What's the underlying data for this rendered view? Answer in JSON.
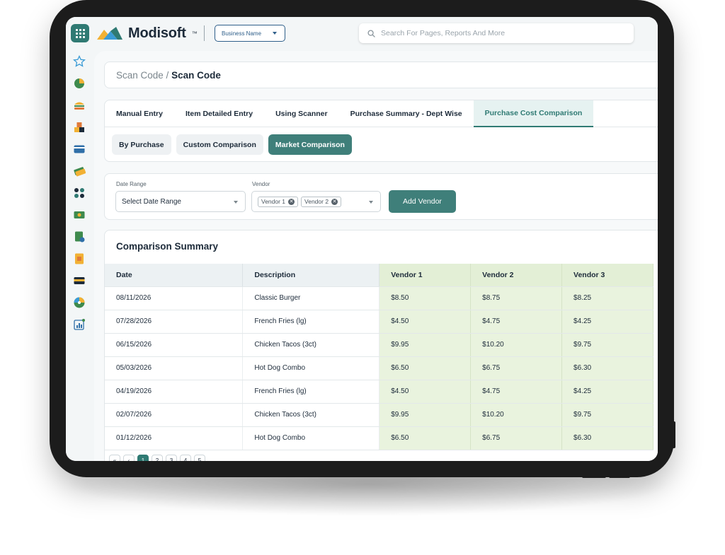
{
  "header": {
    "brand": "Modisoft",
    "business_select": "Business Name",
    "search_placeholder": "Search For Pages, Reports And More"
  },
  "breadcrumb": {
    "parent": "Scan Code /",
    "current": "Scan Code"
  },
  "tabs": [
    {
      "label": "Manual Entry",
      "active": false
    },
    {
      "label": "Item Detailed Entry",
      "active": false
    },
    {
      "label": "Using Scanner",
      "active": false
    },
    {
      "label": "Purchase Summary - Dept Wise",
      "active": false
    },
    {
      "label": "Purchase Cost Comparison",
      "active": true
    }
  ],
  "subtabs": [
    {
      "label": "By Purchase",
      "active": false
    },
    {
      "label": "Custom Comparison",
      "active": false
    },
    {
      "label": "Market Comparison",
      "active": true
    }
  ],
  "filters": {
    "date_range_label": "Date Range",
    "date_range_value": "Select Date Range",
    "vendor_label": "Vendor",
    "vendor_chips": [
      "Vendor 1",
      "Vendor 2"
    ],
    "add_vendor": "Add Vendor"
  },
  "summary": {
    "title": "Comparison Summary",
    "columns": [
      "Date",
      "Description",
      "Vendor 1",
      "Vendor 2",
      "Vendor 3"
    ],
    "rows": [
      [
        "08/11/2026",
        "Classic Burger",
        "$8.50",
        "$8.75",
        "$8.25"
      ],
      [
        "07/28/2026",
        "French Fries (lg)",
        "$4.50",
        "$4.75",
        "$4.25"
      ],
      [
        "06/15/2026",
        "Chicken Tacos (3ct)",
        "$9.95",
        "$10.20",
        "$9.75"
      ],
      [
        "05/03/2026",
        "Hot Dog Combo",
        "$6.50",
        "$6.75",
        "$6.30"
      ],
      [
        "04/19/2026",
        "French Fries (lg)",
        "$4.50",
        "$4.75",
        "$4.25"
      ],
      [
        "02/07/2026",
        "Chicken Tacos (3ct)",
        "$9.95",
        "$10.20",
        "$9.75"
      ],
      [
        "01/12/2026",
        "Hot Dog Combo",
        "$6.50",
        "$6.75",
        "$6.30"
      ]
    ]
  },
  "pager": {
    "pages": [
      "1",
      "2",
      "3",
      "4",
      "5"
    ],
    "active": "1"
  },
  "colors": {
    "accent": "#2f7a73",
    "vendor_highlight": "#e9f3de"
  }
}
